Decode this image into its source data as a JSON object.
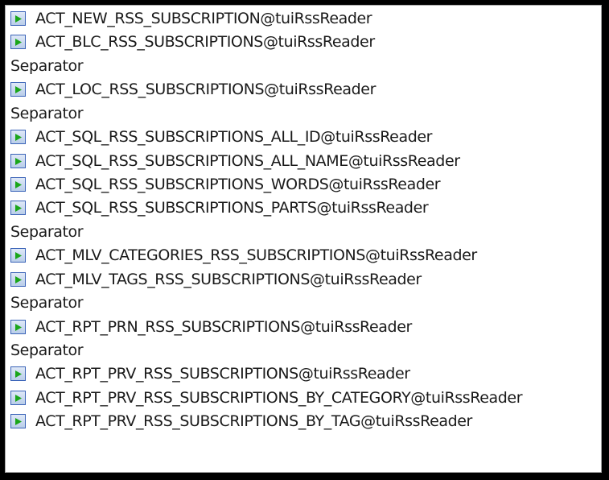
{
  "items": [
    {
      "type": "action",
      "label": "ACT_NEW_RSS_SUBSCRIPTION@tuiRssReader",
      "icon": "play-icon"
    },
    {
      "type": "action",
      "label": "ACT_BLC_RSS_SUBSCRIPTIONS@tuiRssReader",
      "icon": "play-icon"
    },
    {
      "type": "separator",
      "label": "Separator"
    },
    {
      "type": "action",
      "label": "ACT_LOC_RSS_SUBSCRIPTIONS@tuiRssReader",
      "icon": "play-icon"
    },
    {
      "type": "separator",
      "label": "Separator"
    },
    {
      "type": "action",
      "label": "ACT_SQL_RSS_SUBSCRIPTIONS_ALL_ID@tuiRssReader",
      "icon": "play-icon"
    },
    {
      "type": "action",
      "label": "ACT_SQL_RSS_SUBSCRIPTIONS_ALL_NAME@tuiRssReader",
      "icon": "play-icon"
    },
    {
      "type": "action",
      "label": "ACT_SQL_RSS_SUBSCRIPTIONS_WORDS@tuiRssReader",
      "icon": "play-icon"
    },
    {
      "type": "action",
      "label": "ACT_SQL_RSS_SUBSCRIPTIONS_PARTS@tuiRssReader",
      "icon": "play-icon"
    },
    {
      "type": "separator",
      "label": "Separator"
    },
    {
      "type": "action",
      "label": "ACT_MLV_CATEGORIES_RSS_SUBSCRIPTIONS@tuiRssReader",
      "icon": "play-icon"
    },
    {
      "type": "action",
      "label": "ACT_MLV_TAGS_RSS_SUBSCRIPTIONS@tuiRssReader",
      "icon": "play-icon"
    },
    {
      "type": "separator",
      "label": "Separator"
    },
    {
      "type": "action",
      "label": "ACT_RPT_PRN_RSS_SUBSCRIPTIONS@tuiRssReader",
      "icon": "play-icon"
    },
    {
      "type": "separator",
      "label": "Separator"
    },
    {
      "type": "action",
      "label": "ACT_RPT_PRV_RSS_SUBSCRIPTIONS@tuiRssReader",
      "icon": "play-icon"
    },
    {
      "type": "action",
      "label": "ACT_RPT_PRV_RSS_SUBSCRIPTIONS_BY_CATEGORY@tuiRssReader",
      "icon": "play-icon"
    },
    {
      "type": "action",
      "label": "ACT_RPT_PRV_RSS_SUBSCRIPTIONS_BY_TAG@tuiRssReader",
      "icon": "play-icon"
    }
  ],
  "colors": {
    "play_fill": "#1aa61a",
    "icon_border": "#3a63b8",
    "background": "#ffffff",
    "frame": "#000000"
  }
}
